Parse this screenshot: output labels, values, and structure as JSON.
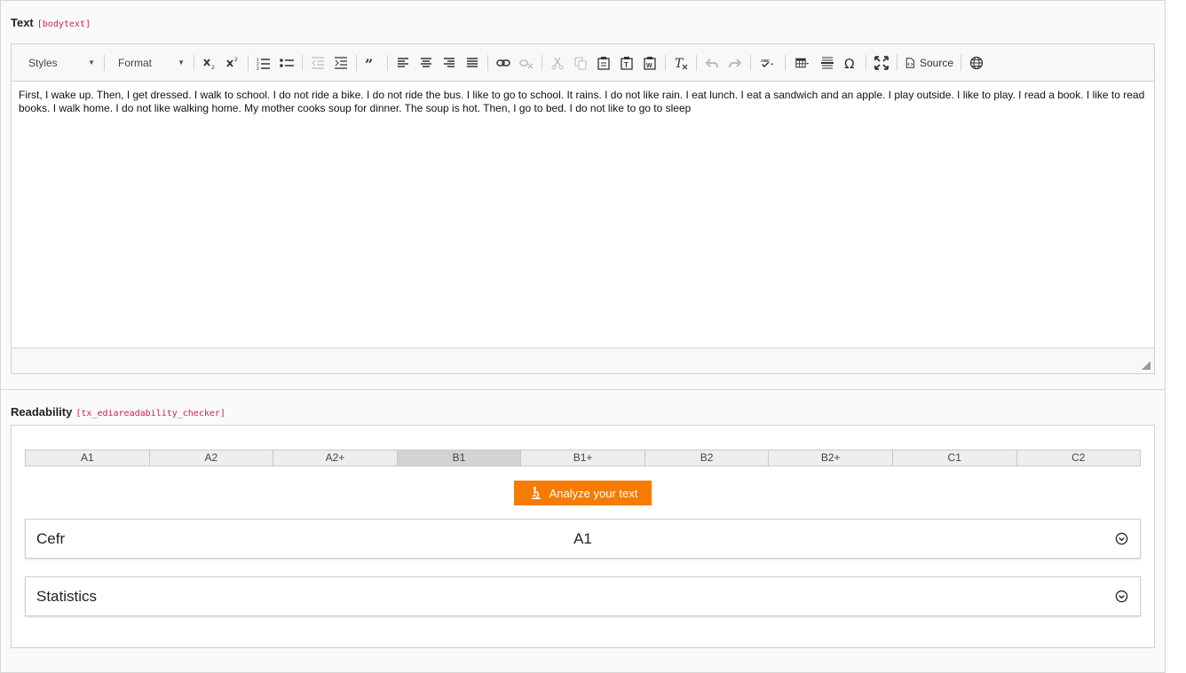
{
  "bodytext_field": {
    "label": "Text",
    "code": "[bodytext]"
  },
  "toolbar": {
    "styles_label": "Styles",
    "format_label": "Format",
    "source_label": "Source",
    "icons": [
      "subscript-icon",
      "superscript-icon",
      "numbered-list-icon",
      "bulleted-list-icon",
      "outdent-icon",
      "indent-icon",
      "blockquote-icon",
      "align-left-icon",
      "align-center-icon",
      "align-right-icon",
      "justify-icon",
      "link-icon",
      "unlink-icon",
      "cut-icon",
      "copy-icon",
      "paste-icon",
      "paste-text-icon",
      "paste-word-icon",
      "remove-format-icon",
      "undo-icon",
      "redo-icon",
      "spellcheck-icon",
      "table-icon",
      "horizontal-line-icon",
      "special-char-icon",
      "maximize-icon",
      "source-icon",
      "language-icon"
    ]
  },
  "editor": {
    "content": "First, I wake up. Then, I get dressed. I walk to school. I do not ride a bike. I do not ride the bus. I like to go to school. It rains. I do not like rain. I eat lunch. I eat a sandwich and an apple. I play outside. I like to play. I read a book. I like to read books. I walk home. I do not like walking home. My mother cooks soup for dinner. The soup is hot. Then, I go to bed. I do not like to go to sleep"
  },
  "readability_field": {
    "label": "Readability",
    "code": "[tx_ediareadability_checker]"
  },
  "levels": [
    "A1",
    "A2",
    "A2+",
    "B1",
    "B1+",
    "B2",
    "B2+",
    "C1",
    "C2"
  ],
  "active_level": "B1",
  "analyze_button": "Analyze your text",
  "accordions": {
    "cefr": {
      "title": "Cefr",
      "value": "A1"
    },
    "statistics": {
      "title": "Statistics"
    }
  },
  "colors": {
    "accent": "#f57c00",
    "active_level_bg": "#d3d3d3"
  }
}
